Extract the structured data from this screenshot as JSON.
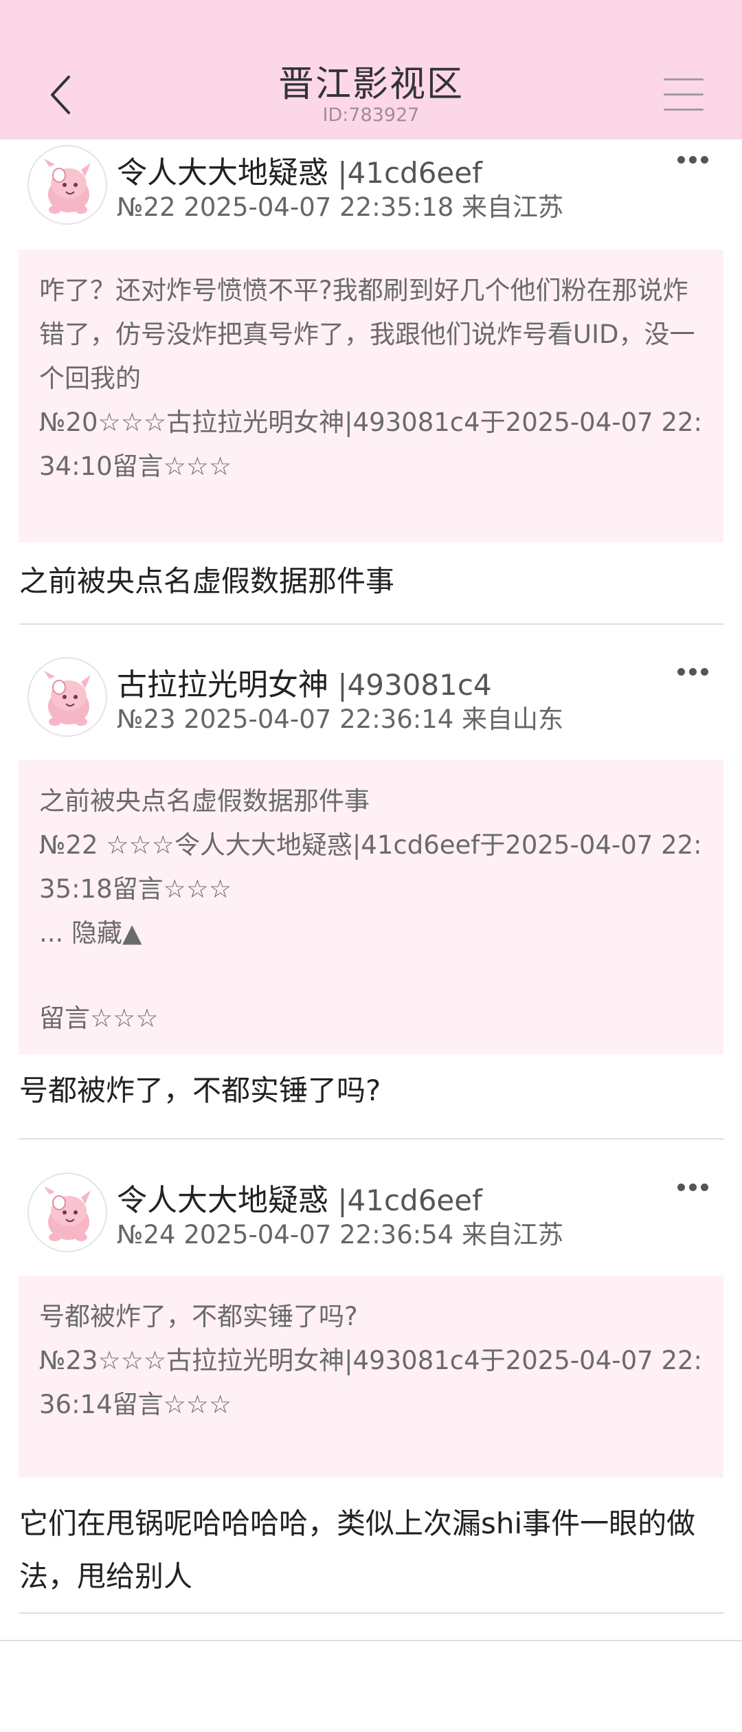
{
  "header": {
    "title": "晋江影视区",
    "subtitle": "ID:783927"
  },
  "posts": [
    {
      "author": "令人大大地疑惑",
      "uid": " |41cd6eef",
      "meta": "№22 2025-04-07 22:35:18 来自江苏",
      "quote": [
        "咋了？还对炸号愤愤不平?我都刷到好几个他们粉在那说炸错了，仿号没炸把真号炸了，我跟他们说炸号看UID，没一个回我的",
        "№20☆☆☆古拉拉光明女神|493081c4于2025-04-07 22:34:10留言☆☆☆"
      ],
      "content": "之前被央点名虚假数据那件事"
    },
    {
      "author": "古拉拉光明女神",
      "uid": " |493081c4",
      "meta": "№23 2025-04-07 22:36:14 来自山东",
      "quote": [
        "之前被央点名虚假数据那件事",
        "№22 ☆☆☆令人大大地疑惑|41cd6eef于2025-04-07 22:35:18留言☆☆☆",
        "... 隐藏▲",
        "留言☆☆☆"
      ],
      "content": "号都被炸了，不都实锤了吗?"
    },
    {
      "author": "令人大大地疑惑",
      "uid": " |41cd6eef",
      "meta": "№24 2025-04-07 22:36:54 来自江苏",
      "quote": [
        "号都被炸了，不都实锤了吗?",
        "№23☆☆☆古拉拉光明女神|493081c4于2025-04-07 22:36:14留言☆☆☆"
      ],
      "content": "它们在甩锅呢哈哈哈哈，类似上次漏shi事件一眼的做法，甩给别人"
    }
  ],
  "icons": {
    "back": "chevron-left-icon",
    "menu": "hamburger-menu-icon",
    "more": "more-dots-icon",
    "avatar": "pink-cartoon-avatar"
  },
  "colors": {
    "header_bg": "#fcd7e8",
    "quote_bg": "#fff0f6"
  }
}
